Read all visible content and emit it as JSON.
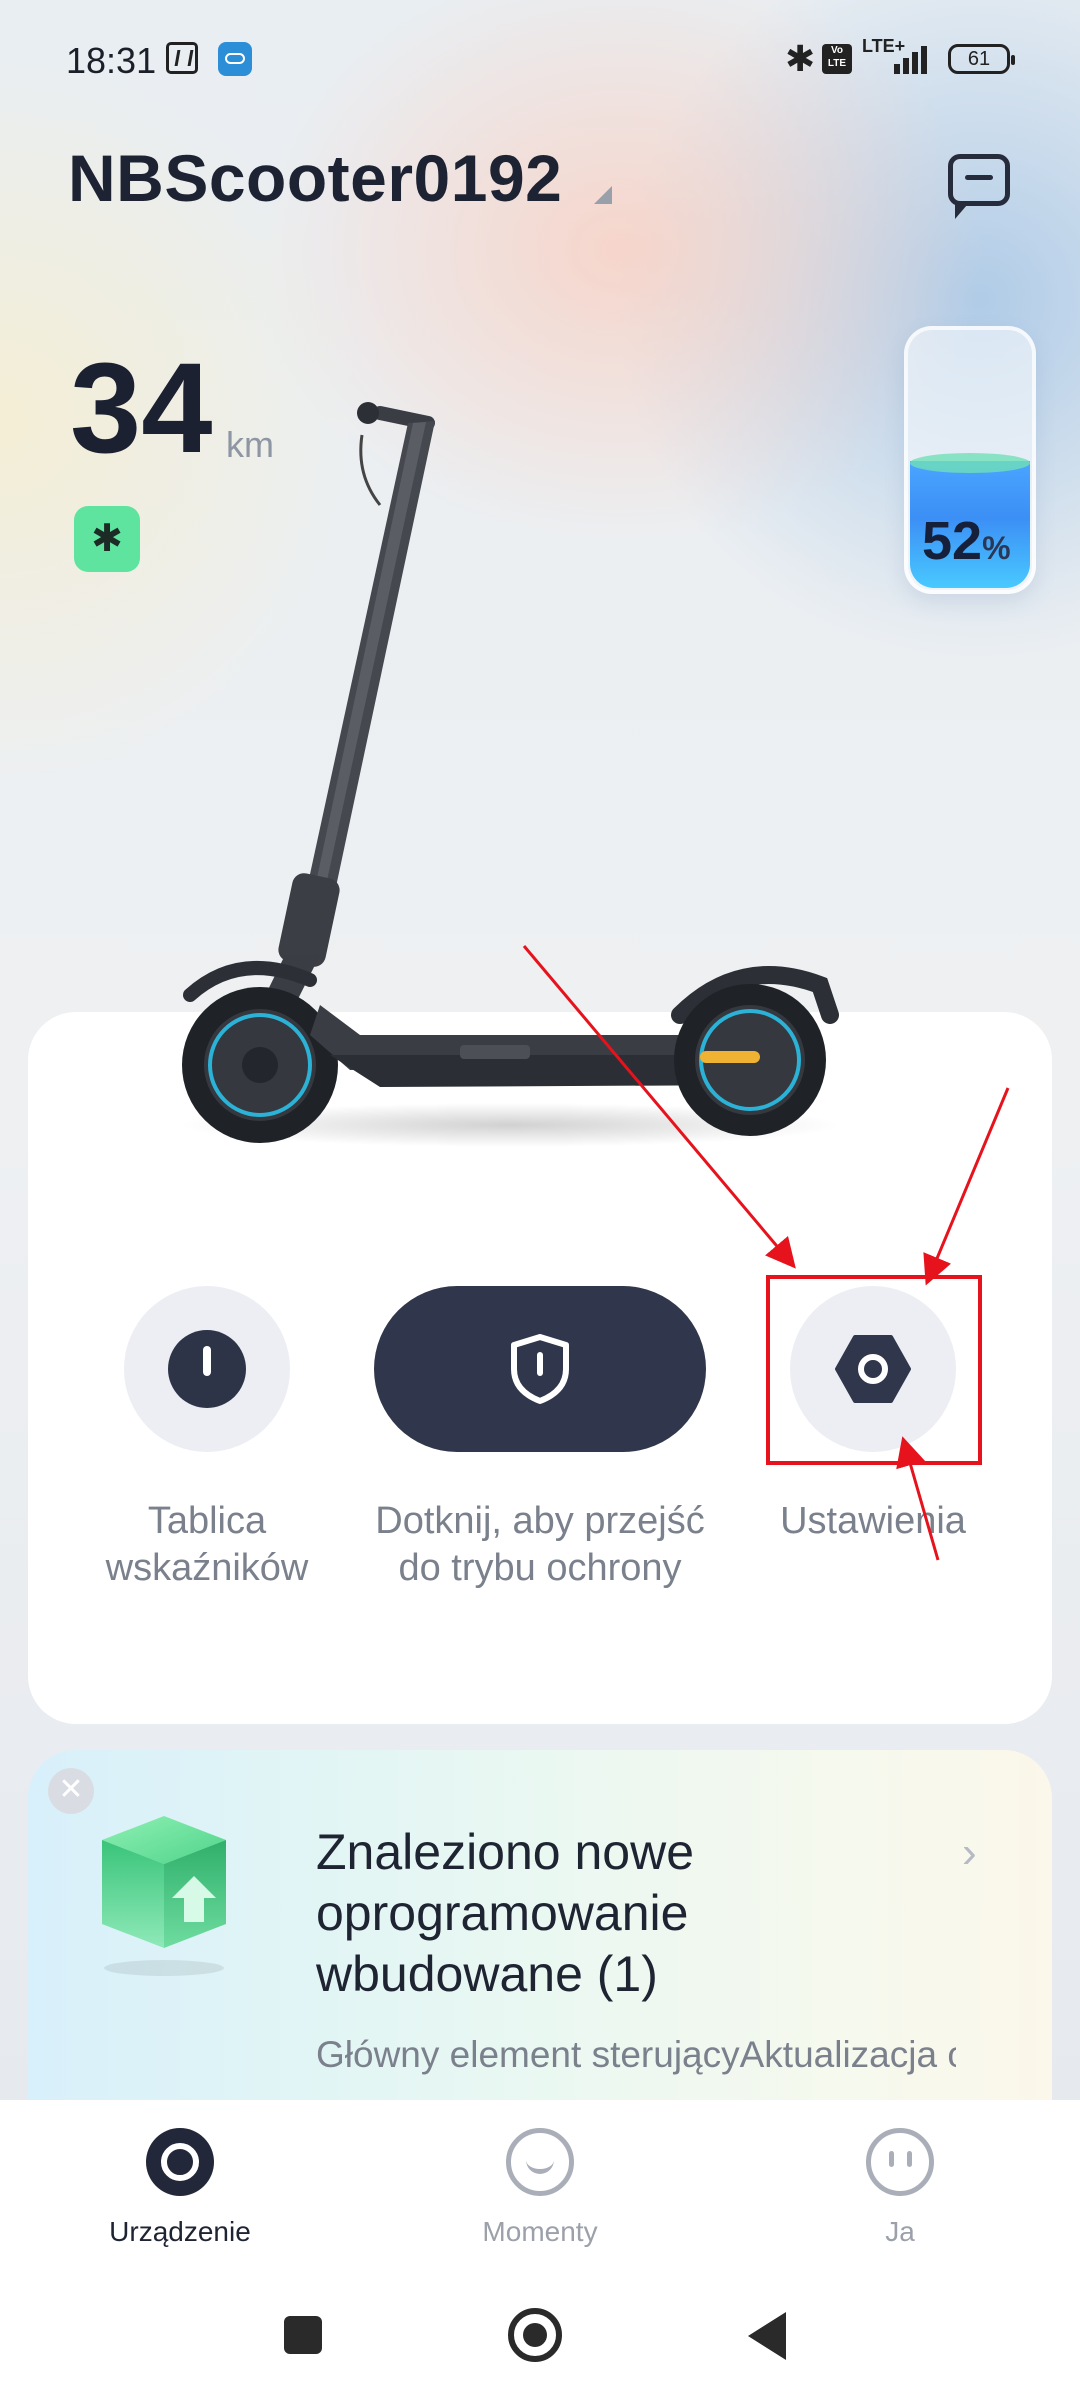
{
  "status_bar": {
    "time": "18:31",
    "lte_label": "LTE+",
    "battery_level": "61",
    "icons": [
      "nfc-icon",
      "app-notification-icon",
      "bluetooth-icon",
      "volte-icon",
      "signal-icon",
      "battery-icon"
    ]
  },
  "header": {
    "device_name": "NBScooter0192"
  },
  "range": {
    "value": "34",
    "unit": "km"
  },
  "battery": {
    "percent": "52",
    "percent_sign": "%",
    "fill_fraction": 0.52
  },
  "controls": {
    "dashboard_label": "Tablica wskaźników",
    "protection_label": "Dotknij, aby przejść do trybu ochrony",
    "settings_label": "Ustawienia"
  },
  "firmware_card": {
    "title": "Znaleziono nowe oprogramowanie wbudowane (1)",
    "description": "Główny element sterującyAktualizacja oprogramow"
  },
  "bottom_nav": {
    "items": [
      {
        "label": "Urządzenie",
        "icon": "device-icon",
        "active": true
      },
      {
        "label": "Momenty",
        "icon": "moments-icon",
        "active": false
      },
      {
        "label": "Ja",
        "icon": "profile-icon",
        "active": false
      }
    ]
  },
  "colors": {
    "accent_dark": "#30364b",
    "bluetooth_badge": "#5fe4a0",
    "battery_fill": "#3c8ff5",
    "annotation_red": "#e6131d"
  }
}
